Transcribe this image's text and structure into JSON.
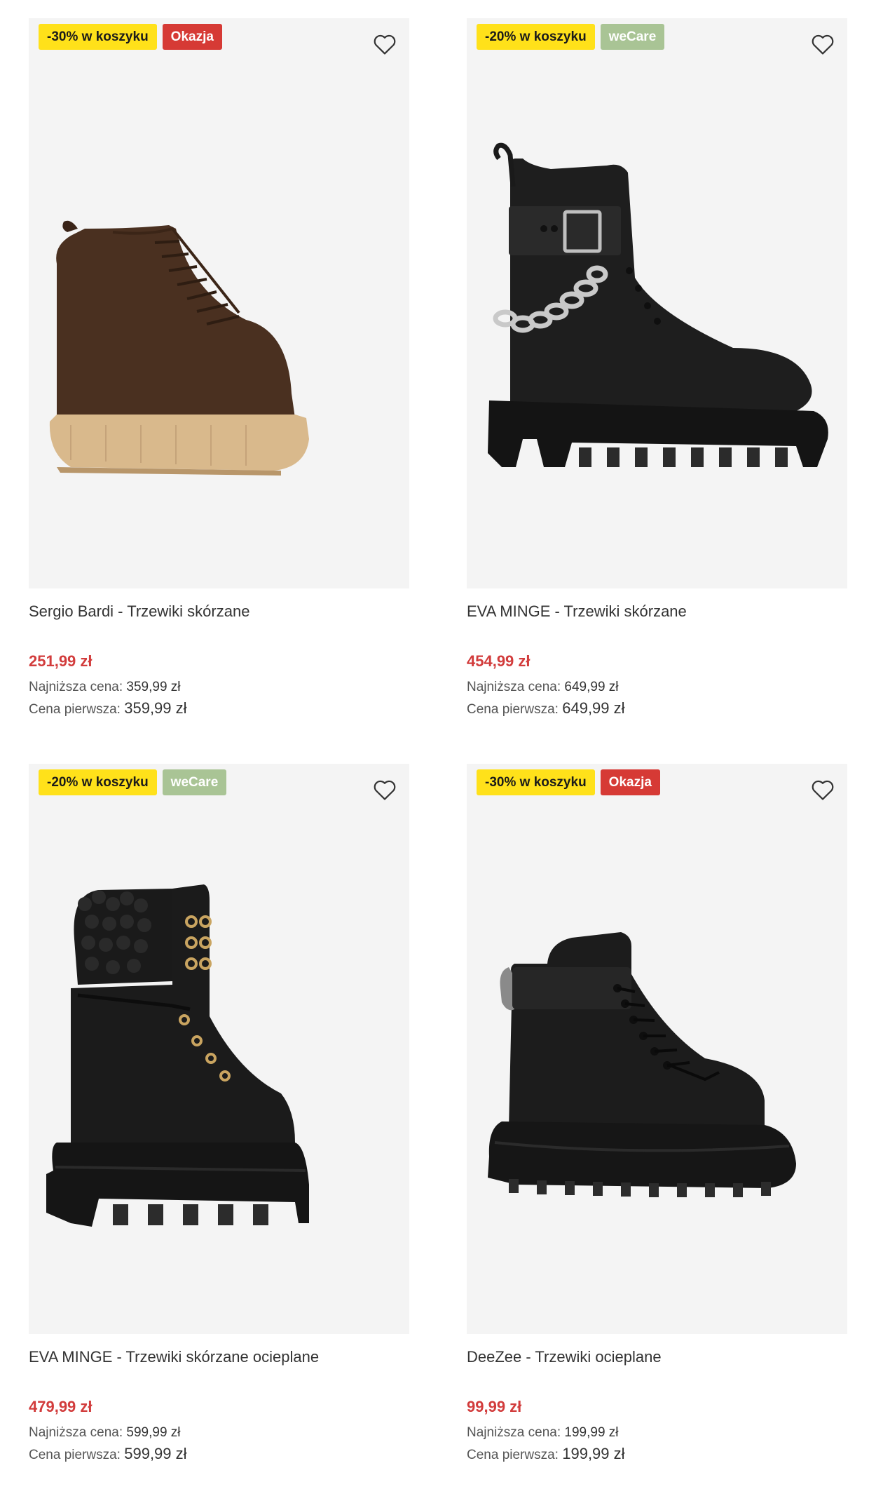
{
  "products": [
    {
      "badges": [
        {
          "text": "-30% w koszyku",
          "style": "yellow"
        },
        {
          "text": "Okazja",
          "style": "red"
        }
      ],
      "title": "Sergio Bardi - Trzewiki skórzane",
      "price": "251,99 zł",
      "lowest_label": "Najniższa cena:",
      "lowest_value": "359,99 zł",
      "first_label": "Cena pierwsza:",
      "first_value": "359,99 zł",
      "image": "brown-suede-lace-up-boot"
    },
    {
      "badges": [
        {
          "text": "-20% w koszyku",
          "style": "yellow"
        },
        {
          "text": "weCare",
          "style": "green"
        }
      ],
      "title": "EVA MINGE - Trzewiki skórzane",
      "price": "454,99 zł",
      "lowest_label": "Najniższa cena:",
      "lowest_value": "649,99 zł",
      "first_label": "Cena pierwsza:",
      "first_value": "649,99 zł",
      "image": "black-chain-combat-boot"
    },
    {
      "badges": [
        {
          "text": "-20% w koszyku",
          "style": "yellow"
        },
        {
          "text": "weCare",
          "style": "green"
        }
      ],
      "title": "EVA MINGE - Trzewiki skórzane ocieplane",
      "price": "479,99 zł",
      "lowest_label": "Najniższa cena:",
      "lowest_value": "599,99 zł",
      "first_label": "Cena pierwsza:",
      "first_value": "599,99 zł",
      "image": "black-shearling-platform-boot"
    },
    {
      "badges": [
        {
          "text": "-30% w koszyku",
          "style": "yellow"
        },
        {
          "text": "Okazja",
          "style": "red"
        }
      ],
      "title": "DeeZee - Trzewiki ocieplane",
      "price": "99,99 zł",
      "lowest_label": "Najniższa cena:",
      "lowest_value": "199,99 zł",
      "first_label": "Cena pierwsza:",
      "first_value": "199,99 zł",
      "image": "black-hiking-lace-boot"
    }
  ],
  "colors": {
    "badge_yellow": "#ffe11a",
    "badge_red": "#d63a35",
    "badge_green": "#a9c495",
    "price_red": "#d23c3c"
  },
  "icons": {
    "favorite": "heart-outline-icon"
  }
}
